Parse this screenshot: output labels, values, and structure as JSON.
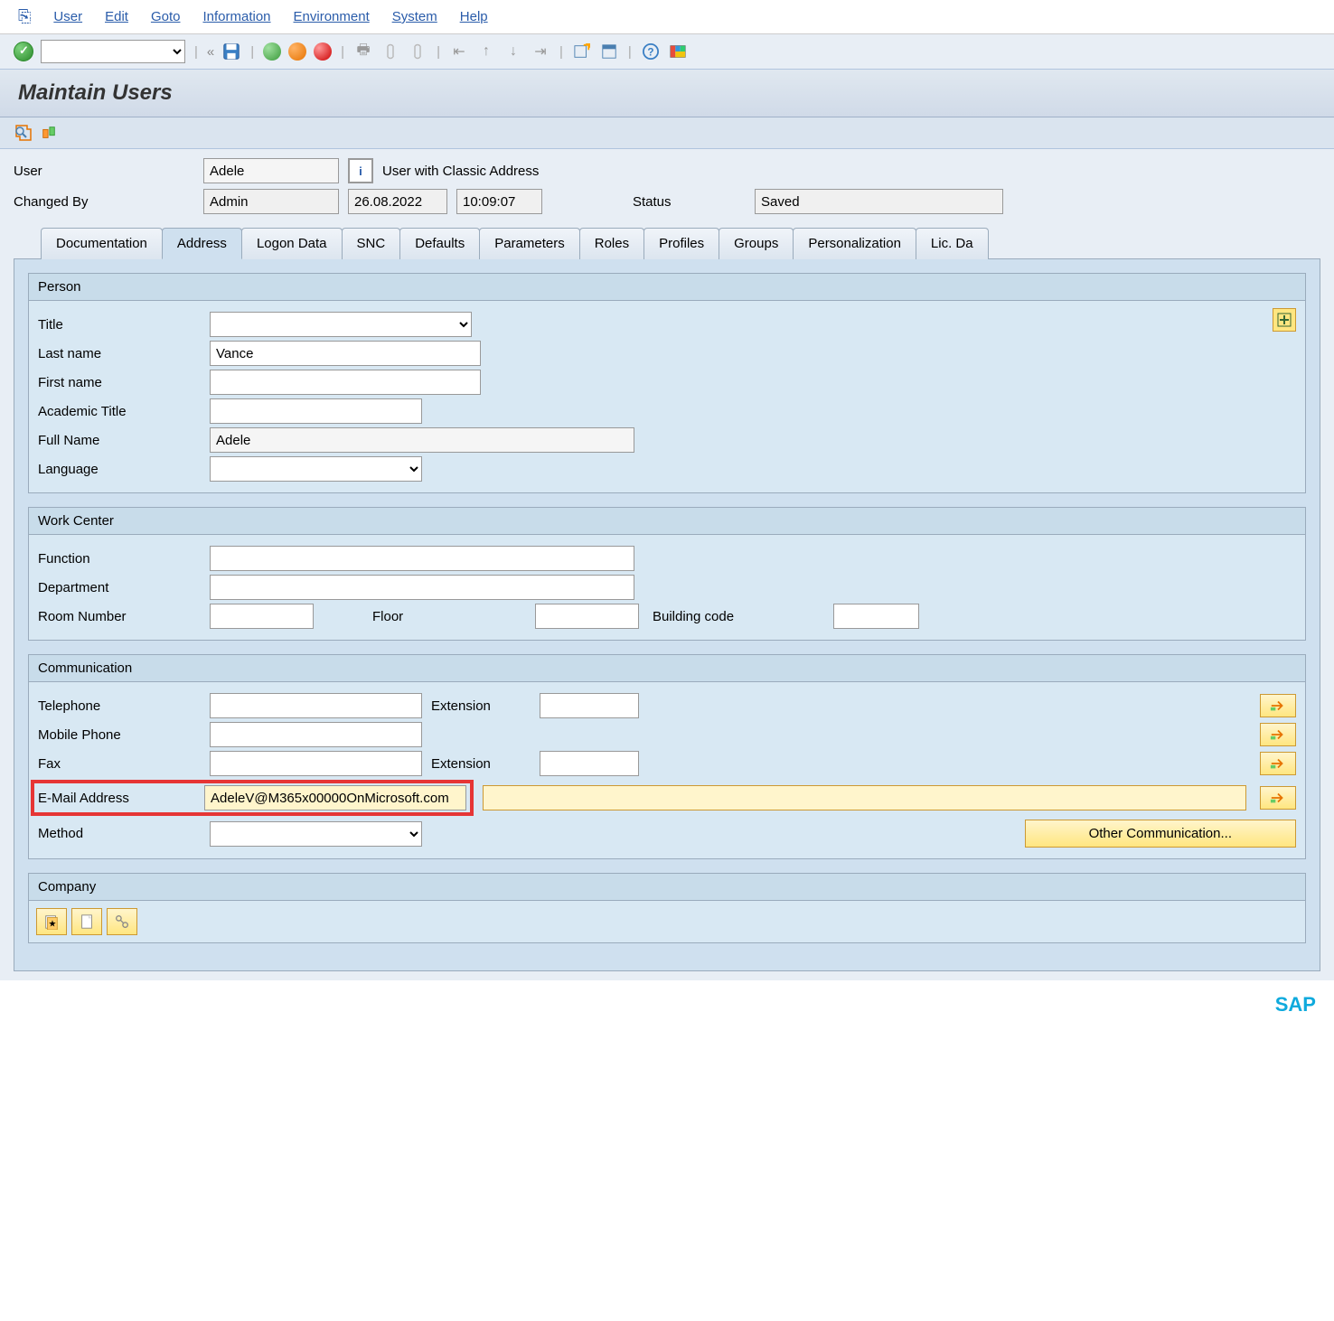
{
  "menu": {
    "user": "User",
    "edit": "Edit",
    "goto": "Goto",
    "information": "Information",
    "environment": "Environment",
    "system": "System",
    "help": "Help"
  },
  "title": "Maintain Users",
  "header": {
    "user_label": "User",
    "user_value": "Adele",
    "classic_address": "User with Classic Address",
    "changed_by_label": "Changed By",
    "changed_by_value": "Admin",
    "changed_date": "26.08.2022",
    "changed_time": "10:09:07",
    "status_label": "Status",
    "status_value": "Saved"
  },
  "tabs": {
    "documentation": "Documentation",
    "address": "Address",
    "logon_data": "Logon Data",
    "snc": "SNC",
    "defaults": "Defaults",
    "parameters": "Parameters",
    "roles": "Roles",
    "profiles": "Profiles",
    "groups": "Groups",
    "personalization": "Personalization",
    "lic_data": "Lic. Da"
  },
  "person": {
    "group": "Person",
    "title_label": "Title",
    "title_value": "",
    "last_name_label": "Last name",
    "last_name_value": "Vance",
    "first_name_label": "First name",
    "first_name_value": "",
    "academic_label": "Academic Title",
    "academic_value": "",
    "full_name_label": "Full Name",
    "full_name_value": "Adele",
    "language_label": "Language",
    "language_value": ""
  },
  "work": {
    "group": "Work Center",
    "function_label": "Function",
    "function_value": "",
    "department_label": "Department",
    "department_value": "",
    "room_label": "Room Number",
    "room_value": "",
    "floor_label": "Floor",
    "floor_value": "",
    "building_label": "Building code",
    "building_value": ""
  },
  "comm": {
    "group": "Communication",
    "tel_label": "Telephone",
    "tel_value": "",
    "ext_label": "Extension",
    "tel_ext_value": "",
    "mobile_label": "Mobile Phone",
    "mobile_value": "",
    "fax_label": "Fax",
    "fax_value": "",
    "fax_ext_value": "",
    "email_label": "E-Mail Address",
    "email_value": "AdeleV@M365x00000OnMicrosoft.com",
    "method_label": "Method",
    "method_value": "",
    "other_comm": "Other Communication..."
  },
  "company": {
    "group": "Company"
  },
  "logo": "SAP"
}
